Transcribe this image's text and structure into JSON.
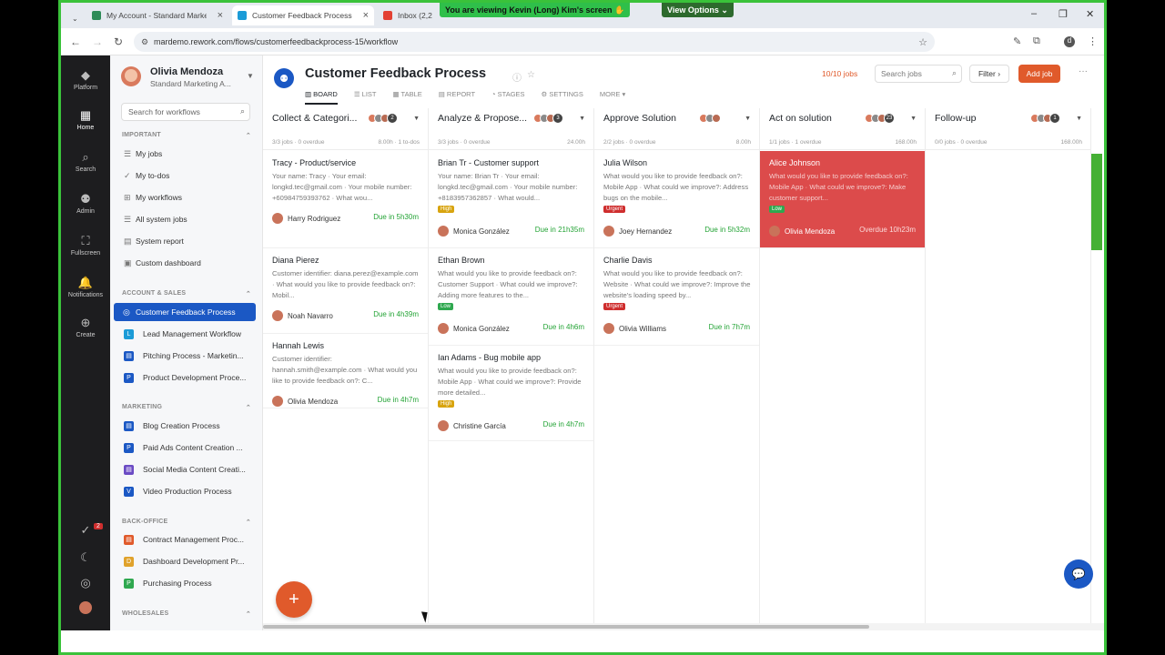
{
  "browser": {
    "tabs": [
      {
        "label": "My Account - Standard Market",
        "color": "#2e8b57"
      },
      {
        "label": "Customer Feedback Process",
        "color": "#1b9bd7"
      },
      {
        "label": "Inbox (2,2",
        "color": "#e34133"
      }
    ],
    "share_banner": "You are viewing  Kevin (Long) Kim's screen",
    "view_options": "View Options",
    "url": "mardemo.rework.com/flows/customerfeedbackprocess-15/workflow"
  },
  "rail": [
    {
      "label": "Platform",
      "icon": "cube-icon"
    },
    {
      "label": "Home",
      "icon": "grid-icon"
    },
    {
      "label": "Search",
      "icon": "search-icon"
    },
    {
      "label": "Admin",
      "icon": "admin-icon"
    },
    {
      "label": "Fullscreen",
      "icon": "fullscreen-icon"
    },
    {
      "label": "Notifications",
      "icon": "bell-icon"
    },
    {
      "label": "Create",
      "icon": "plus-icon"
    }
  ],
  "rail_badge": "2",
  "sidebar": {
    "user_name": "Olivia Mendoza",
    "user_org": "Standard Marketing A...",
    "search_placeholder": "Search for workflows",
    "important_label": "IMPORTANT",
    "important": [
      "My jobs",
      "My to-dos",
      "My workflows",
      "All system jobs",
      "System report",
      "Custom dashboard"
    ],
    "account_sales_label": "ACCOUNT & SALES",
    "account_sales": [
      {
        "label": "Customer Feedback Process",
        "letter": "",
        "color": "#1b58c4"
      },
      {
        "label": "Lead Management Workflow",
        "letter": "L",
        "color": "#1b9bd7"
      },
      {
        "label": "Pitching Process - Marketin...",
        "letter": "",
        "color": "#1b58c4"
      },
      {
        "label": "Product Development Proce...",
        "letter": "P",
        "color": "#1b58c4"
      }
    ],
    "marketing_label": "MARKETING",
    "marketing": [
      {
        "label": "Blog Creation Process",
        "letter": "",
        "color": "#1b58c4"
      },
      {
        "label": "Paid Ads Content Creation ...",
        "letter": "P",
        "color": "#1b58c4"
      },
      {
        "label": "Social Media Content Creati...",
        "letter": "",
        "color": "#6b4bc4"
      },
      {
        "label": "Video Production Process",
        "letter": "V",
        "color": "#1b58c4"
      }
    ],
    "backoffice_label": "BACK-OFFICE",
    "backoffice": [
      {
        "label": "Contract Management Proc...",
        "letter": "",
        "color": "#e05a2b"
      },
      {
        "label": "Dashboard Development Pr...",
        "letter": "D",
        "color": "#e0a22b"
      },
      {
        "label": "Purchasing Process",
        "letter": "P",
        "color": "#2fa84f"
      }
    ],
    "wholesales_label": "WHOLESALES"
  },
  "page": {
    "title": "Customer Feedback Process",
    "tabs": [
      "BOARD",
      "LIST",
      "TABLE",
      "REPORT",
      "STAGES",
      "SETTINGS",
      "MORE"
    ],
    "jobs_count": "10/10 jobs",
    "search_placeholder": "Search jobs",
    "filter_label": "Filter",
    "add_job_label": "Add job"
  },
  "columns": [
    {
      "title": "Collect & Categori...",
      "count": "2",
      "stat": "3/3 jobs · 0 overdue",
      "stat2": "8.00h · 1 to-dos",
      "cards": [
        {
          "title": "Tracy - Product/service",
          "desc": "Your name: Tracy · Your email: longkd.tec@gmail.com · Your mobile number: +60984759393762 · What wou...",
          "badge": "",
          "badge_type": "",
          "owner": "Harry Rodriguez",
          "due": "Due in 5h30m",
          "overdue": false
        },
        {
          "title": "Diana Pierez",
          "desc": "Customer identifier: diana.perez@example.com · What would you like to provide feedback on?: Mobil...",
          "badge": "",
          "badge_type": "",
          "owner": "Noah Navarro",
          "due": "Due in 4h39m",
          "overdue": false
        },
        {
          "title": "Hannah Lewis",
          "desc": "Customer identifier: hannah.smith@example.com · What would you like to provide feedback on?: C...",
          "badge": "",
          "badge_type": "",
          "owner": "Olivia Mendoza",
          "due": "Due in 4h7m",
          "overdue": false
        }
      ]
    },
    {
      "title": "Analyze & Propose...",
      "count": "3",
      "stat": "3/3 jobs · 0 overdue",
      "stat2": "24.00h",
      "cards": [
        {
          "title": "Brian Tr - Customer support",
          "desc": "Your name: Brian Tr · Your email: longkd.tec@gmail.com · Your mobile number: +8183957362857 · What would...",
          "badge": "High",
          "badge_type": "high",
          "owner": "Monica González",
          "due": "Due in 21h35m",
          "overdue": false
        },
        {
          "title": "Ethan Brown",
          "desc": "What would you like to provide feedback on?: Customer Support · What could we improve?: Adding more features to the...",
          "badge": "Low",
          "badge_type": "low",
          "owner": "Monica González",
          "due": "Due in 4h6m",
          "overdue": false
        },
        {
          "title": "Ian Adams - Bug mobile app",
          "desc": "What would you like to provide feedback on?: Mobile App · What could we improve?: Provide more detailed...",
          "badge": "High",
          "badge_type": "high",
          "owner": "Christine García",
          "due": "Due in 4h7m",
          "overdue": false
        }
      ]
    },
    {
      "title": "Approve Solution",
      "count": "",
      "stat": "2/2 jobs · 0 overdue",
      "stat2": "8.00h",
      "cards": [
        {
          "title": "Julia Wilson",
          "desc": "What would you like to provide feedback on?: Mobile App · What could we improve?: Address bugs on the mobile...",
          "badge": "Urgent",
          "badge_type": "urgent",
          "owner": "Joey Hernandez",
          "due": "Due in 5h32m",
          "overdue": false
        },
        {
          "title": "Charlie Davis",
          "desc": "What would you like to provide feedback on?: Website · What could we improve?: Improve the website's loading speed by...",
          "badge": "Urgent",
          "badge_type": "urgent",
          "owner": "Olivia Williams",
          "due": "Due in 7h7m",
          "overdue": false
        }
      ]
    },
    {
      "title": "Act on solution",
      "count": "23",
      "stat": "1/1 jobs · 1 overdue",
      "stat2": "168.00h",
      "cards": [
        {
          "title": "Alice Johnson",
          "desc": "What would you like to provide feedback on?: Mobile App · What could we improve?: Make customer support...",
          "badge": "Low",
          "badge_type": "low",
          "owner": "Olivia Mendoza",
          "due": "Overdue 10h23m",
          "overdue": true
        }
      ]
    },
    {
      "title": "Follow-up",
      "count": "1",
      "stat": "0/0 jobs · 0 overdue",
      "stat2": "168.00h",
      "cards": []
    }
  ],
  "fab_label": "+"
}
